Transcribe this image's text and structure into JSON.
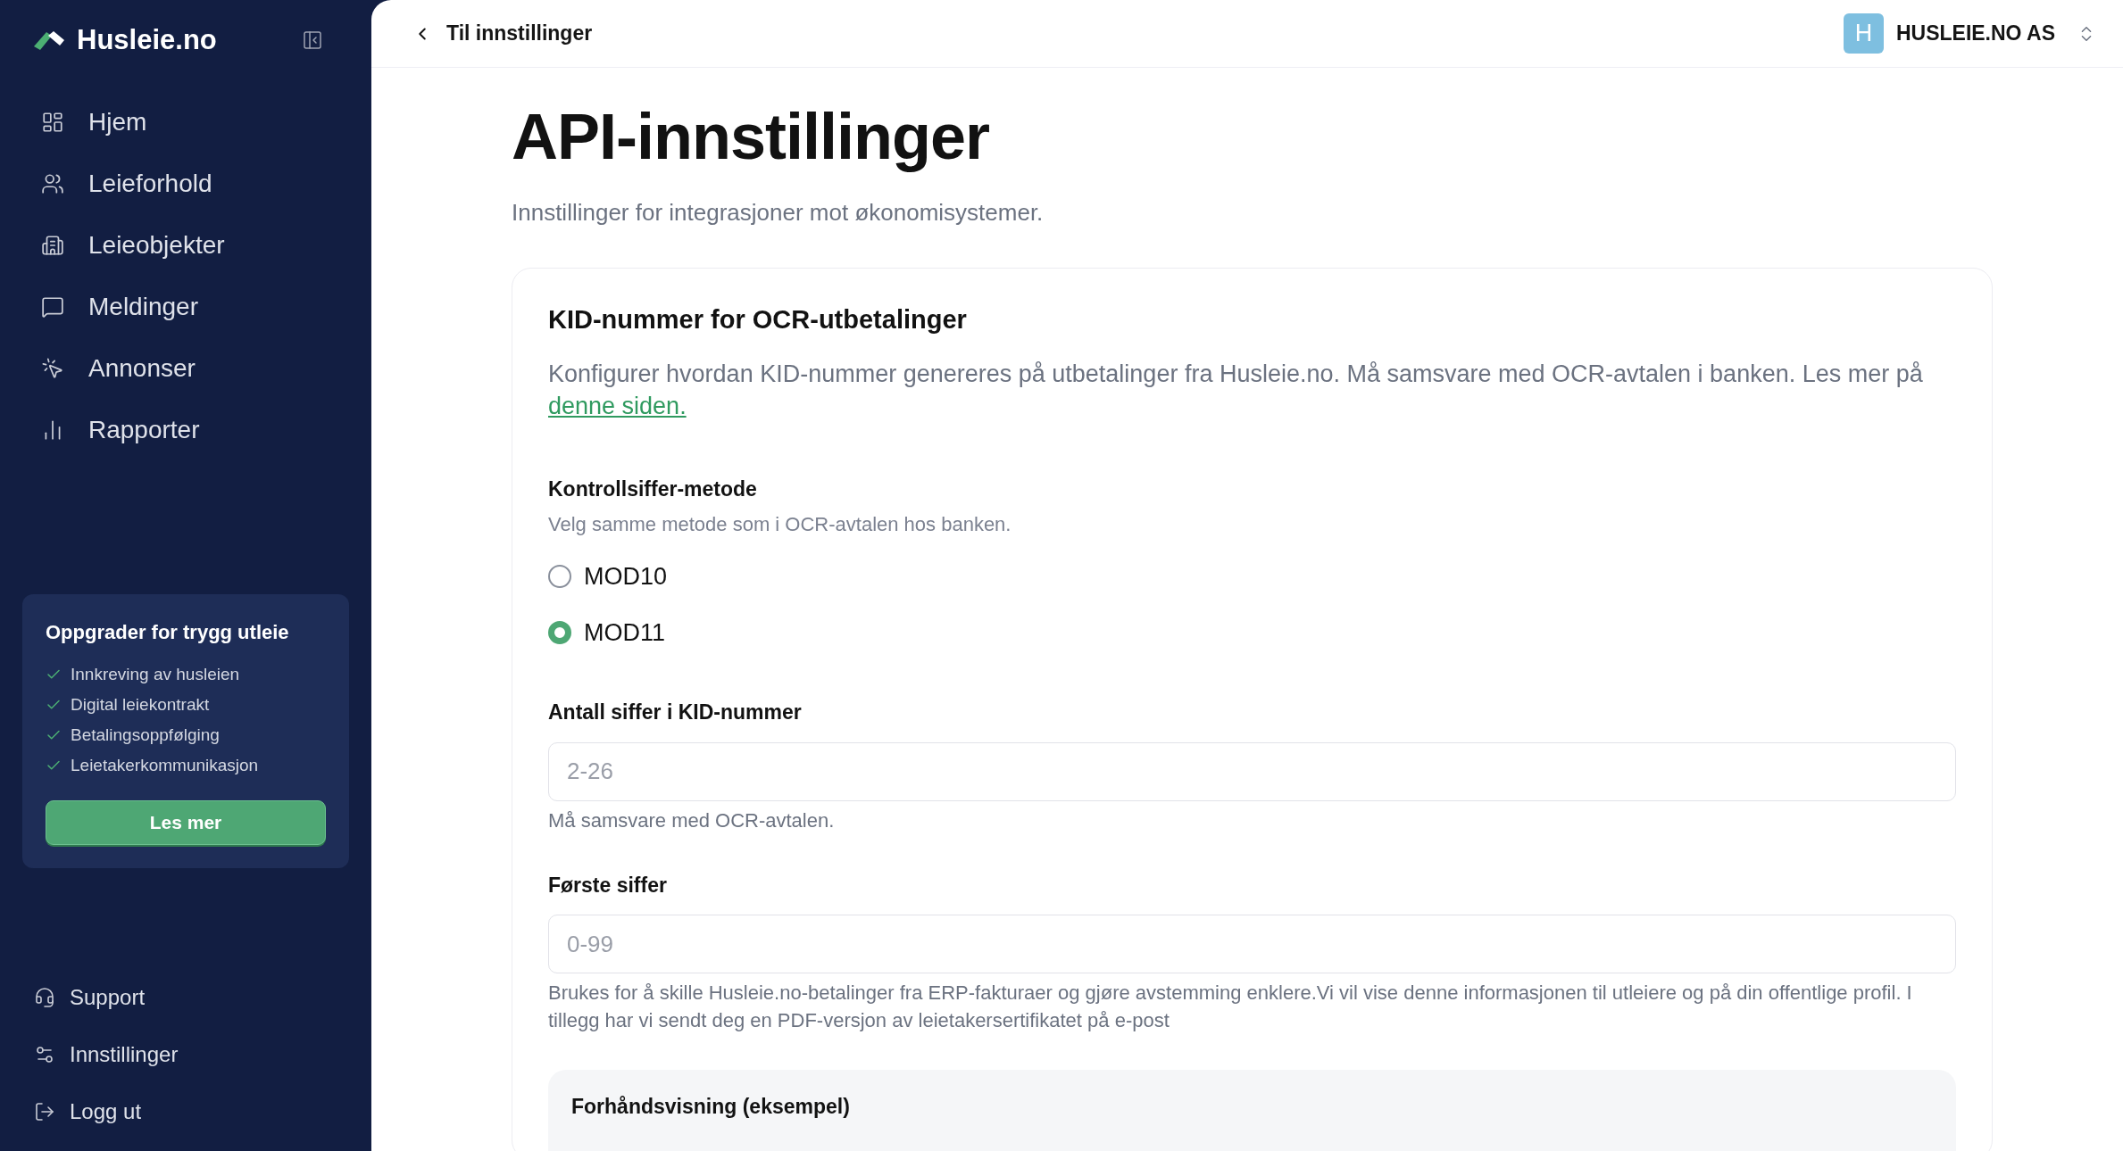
{
  "sidebar": {
    "brand": "Husleie.no",
    "items": [
      {
        "label": "Hjem",
        "kind": "home"
      },
      {
        "label": "Leieforhold",
        "kind": "users"
      },
      {
        "label": "Leieobjekter",
        "kind": "building"
      },
      {
        "label": "Meldinger",
        "kind": "message"
      },
      {
        "label": "Annonser",
        "kind": "pointer"
      },
      {
        "label": "Rapporter",
        "kind": "chart"
      }
    ],
    "upgrade": {
      "title": "Oppgrader for trygg utleie",
      "features": [
        "Innkreving av husleien",
        "Digital leiekontrakt",
        "Betalingsoppfølging",
        "Leietakerkommunikasjon"
      ],
      "button": "Les mer"
    },
    "bottom_items": [
      {
        "label": "Support",
        "kind": "support"
      },
      {
        "label": "Innstillinger",
        "kind": "settings"
      },
      {
        "label": "Logg ut",
        "kind": "logout"
      }
    ]
  },
  "header": {
    "back_link": "Til innstillinger",
    "org_initial": "H",
    "org_name": "HUSLEIE.NO AS"
  },
  "page": {
    "title": "API-innstillinger",
    "subtitle": "Innstillinger for integrasjoner mot økonomisystemer.",
    "card": {
      "title": "KID-nummer for OCR-utbetalinger",
      "description": "Konfigurer hvordan KID-nummer genereres på utbetalinger fra Husleie.no. Må samsvare med OCR-avtalen i banken. Les mer på",
      "link": "denne siden.",
      "method": {
        "label": "Kontrollsiffer-metode",
        "hint": "Velg samme metode som i OCR-avtalen hos banken.",
        "options": [
          {
            "label": "MOD10",
            "selected": false
          },
          {
            "label": "MOD11",
            "selected": true
          }
        ]
      },
      "fields": [
        {
          "label": "Antall siffer i KID-nummer",
          "placeholder": "2-26",
          "help": "Må samsvare med OCR-avtalen."
        },
        {
          "label": "Første siffer",
          "placeholder": "0-99",
          "help": "Brukes for å skille Husleie.no-betalinger fra ERP-fakturaer og gjøre avstemming enklere.Vi vil vise denne informasjonen til utleiere og på din offentlige profil. I tillegg har vi sendt deg en PDF-versjon av leietakersertifikatet på e-post"
        }
      ],
      "preview": {
        "title": "Forhåndsvisning (eksempel)"
      }
    }
  }
}
